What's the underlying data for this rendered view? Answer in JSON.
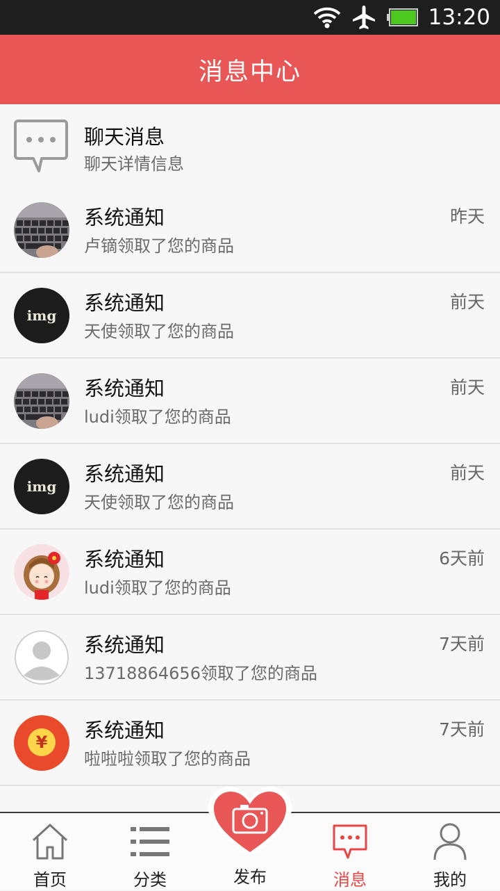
{
  "status_bar": {
    "time": "13:20",
    "icons": [
      "wifi-icon",
      "airplane-icon",
      "battery-icon"
    ]
  },
  "header": {
    "title": "消息中心"
  },
  "chat_entry": {
    "title": "聊天消息",
    "subtitle": "聊天详情信息",
    "icon": "chat-bubble-icon"
  },
  "messages": [
    {
      "title": "系统通知",
      "text": "卢镝领取了您的商品",
      "time": "昨天",
      "avatar": "keyboard-photo"
    },
    {
      "title": "系统通知",
      "text": "天使领取了您的商品",
      "time": "前天",
      "avatar": "img-placeholder",
      "avatar_text": "img"
    },
    {
      "title": "系统通知",
      "text": "ludi领取了您的商品",
      "time": "前天",
      "avatar": "keyboard-photo"
    },
    {
      "title": "系统通知",
      "text": "天使领取了您的商品",
      "time": "前天",
      "avatar": "img-placeholder",
      "avatar_text": "img"
    },
    {
      "title": "系统通知",
      "text": "ludi领取了您的商品",
      "time": "6天前",
      "avatar": "cartoon-girl"
    },
    {
      "title": "系统通知",
      "text": "13718864656领取了您的商品",
      "time": "7天前",
      "avatar": "default-user"
    },
    {
      "title": "系统通知",
      "text": "啦啦啦领取了您的商品",
      "time": "7天前",
      "avatar": "red-envelope",
      "avatar_text": "¥"
    }
  ],
  "tabs": [
    {
      "label": "首页",
      "icon": "home-icon"
    },
    {
      "label": "分类",
      "icon": "list-icon"
    },
    {
      "label": "发布",
      "icon": "camera-heart-icon"
    },
    {
      "label": "消息",
      "icon": "message-icon",
      "active": true
    },
    {
      "label": "我的",
      "icon": "user-icon"
    }
  ],
  "colors": {
    "accent": "#e85656",
    "active_tab": "#e84545",
    "status_bar": "#1e1e1e"
  }
}
